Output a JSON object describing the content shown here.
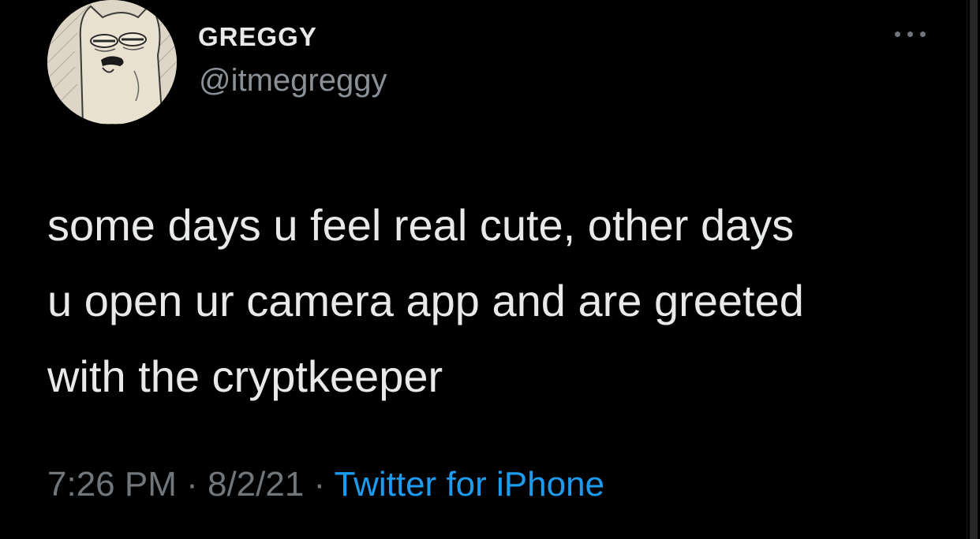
{
  "author": {
    "display_name": "GREGGY",
    "handle": "@itmegreggy",
    "avatar_icon": "cartoon-face-avatar"
  },
  "tweet": {
    "lines": [
      "some days u feel real cute, other days",
      "u open ur camera app and are greeted",
      "with the cryptkeeper"
    ]
  },
  "meta": {
    "time": "7:26 PM",
    "sep1": " · ",
    "date": "8/2/21",
    "sep2": " · ",
    "source": "Twitter for iPhone"
  },
  "colors": {
    "background": "#000000",
    "text": "#e7e9ea",
    "secondary": "#71767b",
    "link": "#1d9bf0"
  },
  "icons": {
    "more": "more-options-icon"
  }
}
